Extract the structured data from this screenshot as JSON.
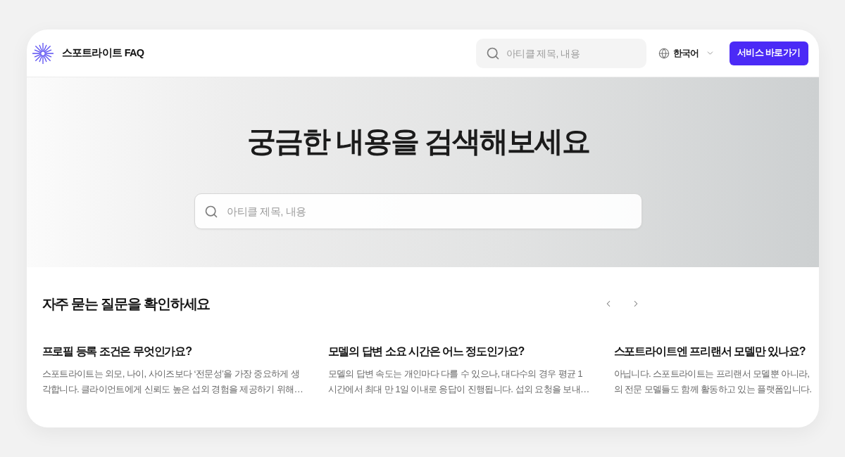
{
  "header": {
    "logo_text": "스포트라이트 FAQ",
    "search": {
      "placeholder": "아티클 제목, 내용"
    },
    "language": "한국어",
    "cta_button": "서비스 바로가기"
  },
  "hero": {
    "title": "궁금한 내용을 검색해보세요",
    "search": {
      "placeholder": "아티클 제목, 내용"
    }
  },
  "faq": {
    "heading": "자주 묻는 질문을 확인하세요",
    "items": [
      {
        "question": "프로필 등록 조건은 무엇인가요?",
        "answer": "스포트라이트는 외모, 나이, 사이즈보다 ‘전문성’을 가장 중요하게 생\n각합니다. 클라이언트에게 신뢰도 높은 섭외 경험을 제공하기 위해…"
      },
      {
        "question": "모델의 답변 소요 시간은 어느 정도인가요?",
        "answer": "모델의 답변 속도는 개인마다 다를 수 있으나, 대다수의 경우 평균 1\n시간에서 최대 만 1일 이내로 응답이 진행됩니다. 섭외 요청을 보내…"
      },
      {
        "question": "스포트라이트엔 프리랜서 모델만 있나요?",
        "answer": "아닙니다. 스포트라이트는 프리랜서 모델뿐 아니라,\n의 전문 모델들도 함께 활동하고 있는 플랫폼입니다."
      }
    ]
  }
}
